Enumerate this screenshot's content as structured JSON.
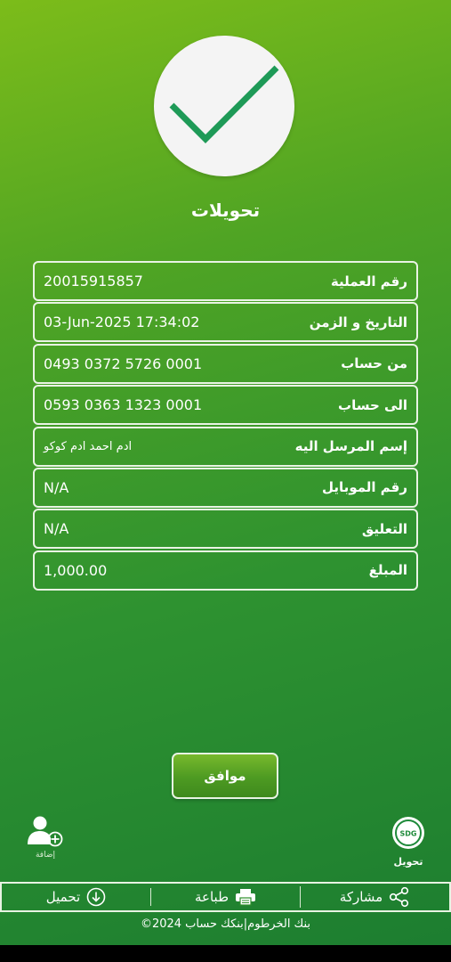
{
  "title": "تحويلات",
  "details": [
    {
      "label": "رقم العملية",
      "value": "20015915857"
    },
    {
      "label": "التاريخ و الزمن",
      "value": "03-Jun-2025 17:34:02"
    },
    {
      "label": "من حساب",
      "value": "0493 0372 5726 0001"
    },
    {
      "label": "الى حساب",
      "value": "0593 0363 1323 0001"
    },
    {
      "label": "إسم المرسل اليه",
      "value": "ادم احمد ادم كوكو"
    },
    {
      "label": "رقم الموبايل",
      "value": "N/A"
    },
    {
      "label": "التعليق",
      "value": "N/A"
    },
    {
      "label": "المبلغ",
      "value": "1,000.00"
    }
  ],
  "ok_button": "موافق",
  "add_contact_label": "إضافة",
  "transfer_label": "تحويل",
  "transfer_badge": "SDG",
  "bottom_bar": {
    "share": "مشاركة",
    "print": "طباعة",
    "download": "تحميل"
  },
  "footer": "©2024 بنك الخرطوم|بنكك حساب",
  "colors": {
    "check": "#1e9a57",
    "background_top": "#7cbc1a",
    "background_bottom": "#1c7d30"
  }
}
